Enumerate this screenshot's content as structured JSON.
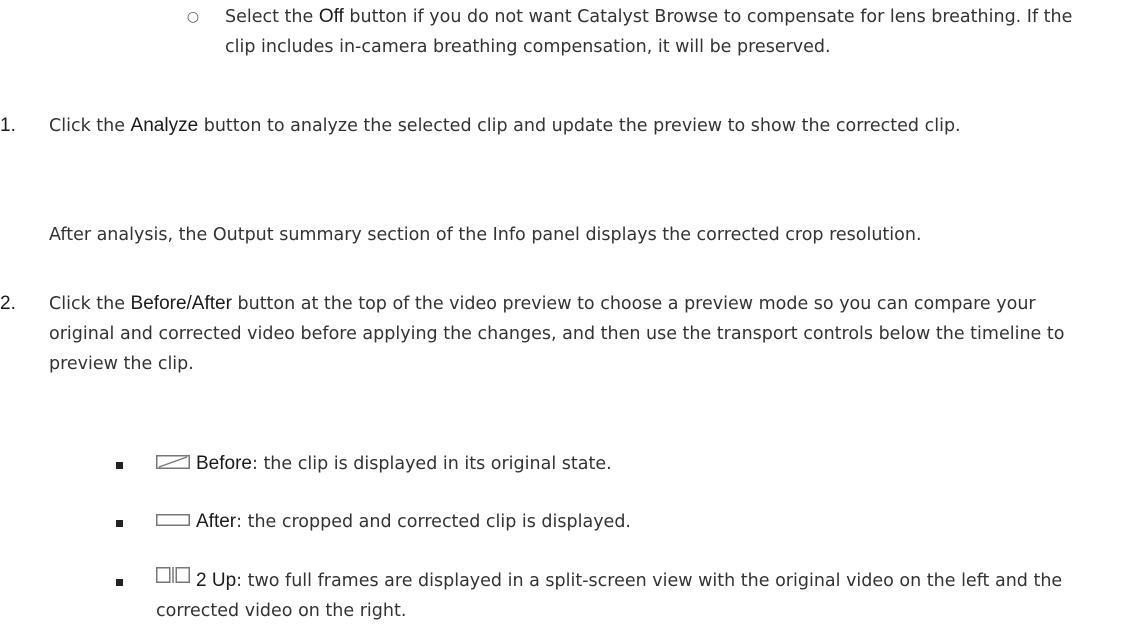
{
  "sub_item": {
    "marker": "○",
    "prefix": "Select the ",
    "bold": "Off",
    "suffix": " button if you do not want Catalyst Browse to compensate for lens breathing. If the clip includes in-camera breathing compensation, it will be preserved."
  },
  "steps": [
    {
      "number": "1.",
      "prefix": "Click the ",
      "bold": "Analyze",
      "suffix": " button to analyze the selected clip and update the preview to show the corrected clip."
    },
    {
      "number": "2.",
      "prefix": "Click the ",
      "bold": "Before/After",
      "suffix": " button at the top of the video preview to choose a preview mode so you can compare your original and corrected video before applying the changes, and then use the transport controls below the timeline to preview the clip."
    }
  ],
  "after_analysis": "After analysis, the Output summary section of the Info panel displays the corrected crop resolution.",
  "modes": [
    {
      "icon": "before-mode-icon",
      "label": "Before",
      "text": ": the clip is displayed in its original state."
    },
    {
      "icon": "after-mode-icon",
      "label": "After",
      "text": ": the cropped and corrected clip is displayed."
    },
    {
      "icon": "two-up-mode-icon",
      "label": "2 Up",
      "text": ": two full frames are displayed in a split-screen view with the original video on the left and the corrected video on the right."
    }
  ]
}
